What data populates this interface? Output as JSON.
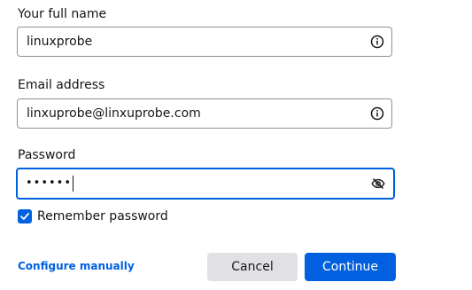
{
  "form": {
    "name_label": "Your full name",
    "name_value": "linuxprobe",
    "email_label": "Email address",
    "email_value": "linxuprobe@linxuprobe.com",
    "password_label": "Password",
    "password_value": "••••••",
    "remember_label": "Remember password",
    "remember_checked": true
  },
  "footer": {
    "configure_link": "Configure manually",
    "cancel_label": "Cancel",
    "continue_label": "Continue"
  },
  "icons": {
    "name_field": "info-icon",
    "email_field": "info-icon",
    "password_field": "eye-slash-icon",
    "checkbox": "checkmark-icon"
  },
  "colors": {
    "accent": "#0060df",
    "secondary_button": "#e1e1e5",
    "field_border": "#8f8f9d",
    "text": "#15141a"
  }
}
